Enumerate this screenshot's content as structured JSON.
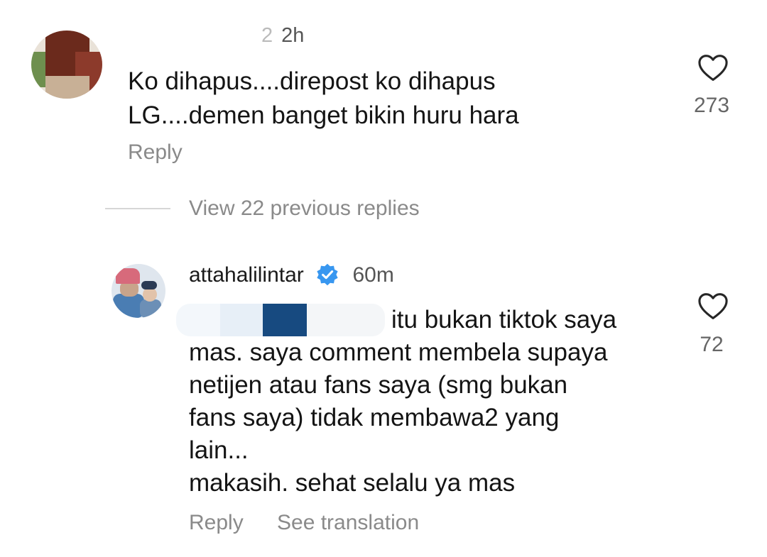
{
  "comment1": {
    "username_fragment": "2",
    "time": "2h",
    "text_line1": "Ko dihapus....direpost ko dihapus",
    "text_line2": "LG....demen banget bikin huru hara",
    "reply_label": "Reply",
    "like_count": "273"
  },
  "replies": {
    "view_previous_label": "View 22 previous replies"
  },
  "comment2": {
    "username": "attahalilintar",
    "time": "60m",
    "text_line1": "itu bukan tiktok saya",
    "text_line2": "mas. saya comment membela supaya",
    "text_line3": "netijen atau fans saya (smg bukan",
    "text_line4": "fans saya) tidak membawa2 yang",
    "text_line5": "lain...",
    "text_line6": "makasih. sehat selalu ya mas",
    "reply_label": "Reply",
    "see_translation_label": "See translation",
    "like_count": "72"
  },
  "icons": {
    "like": "heart-outline-icon",
    "verified": "verified-badge-icon"
  },
  "colors": {
    "verified_blue": "#3897f0",
    "secondary_text": "#8a8a8a"
  }
}
